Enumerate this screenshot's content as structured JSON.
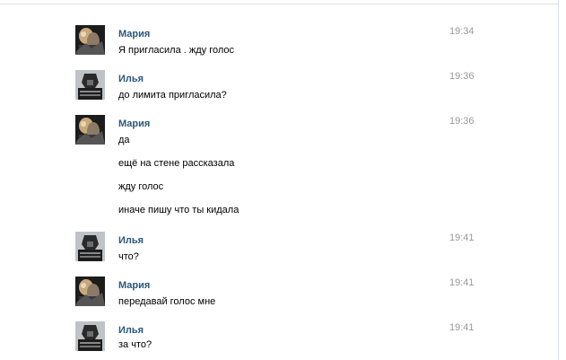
{
  "messages": [
    {
      "author": "Мария",
      "time": "19:34",
      "avatar": "avatar-maria",
      "lines": [
        "Я пригласила . жду голос"
      ]
    },
    {
      "author": "Илья",
      "time": "19:36",
      "avatar": "avatar-ilya",
      "lines": [
        "до лимита пригласила?"
      ]
    },
    {
      "author": "Мария",
      "time": "19:36",
      "avatar": "avatar-maria",
      "lines": [
        "да",
        "ещё на стене рассказала",
        "жду голос",
        "иначе пишу что ты кидала"
      ]
    },
    {
      "author": "Илья",
      "time": "19:41",
      "avatar": "avatar-ilya",
      "lines": [
        "что?"
      ]
    },
    {
      "author": "Мария",
      "time": "19:41",
      "avatar": "avatar-maria",
      "lines": [
        "передавай голос мне"
      ]
    },
    {
      "author": "Илья",
      "time": "19:41",
      "avatar": "avatar-ilya",
      "lines": [
        "за что?"
      ]
    }
  ],
  "colors": {
    "author_link": "#2b587a",
    "timestamp": "#999999",
    "text": "#000000",
    "border": "#d8dfe6"
  }
}
